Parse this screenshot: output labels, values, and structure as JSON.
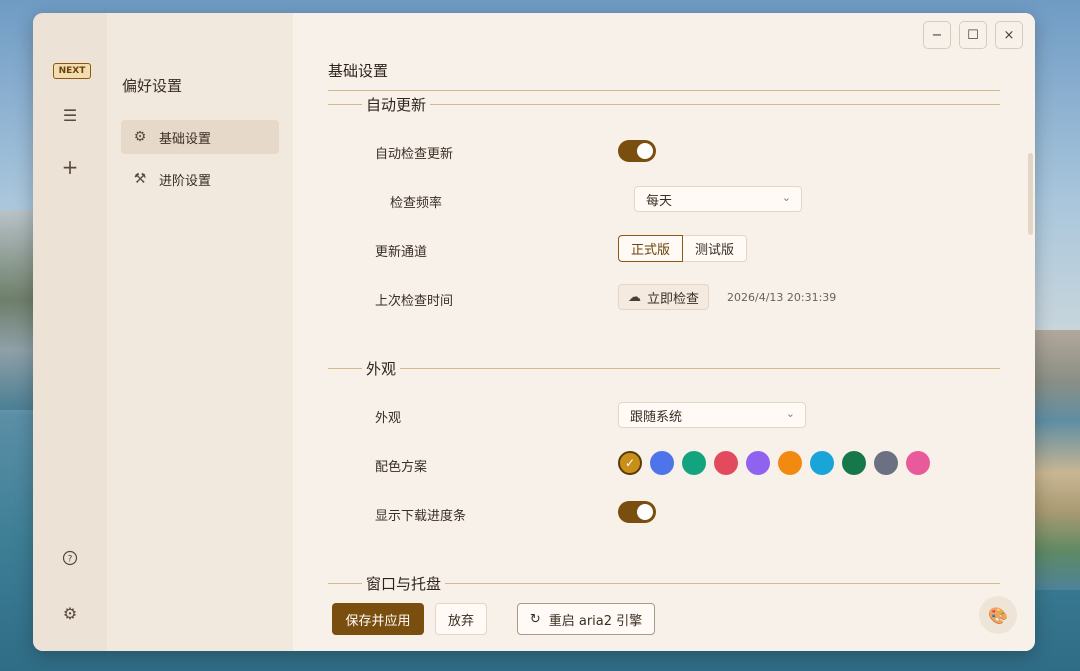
{
  "rail": {
    "logo_text": "NEXT",
    "icons": [
      "list-icon",
      "add-icon",
      "help-icon",
      "settings-icon"
    ]
  },
  "sidebar": {
    "title": "偏好设置",
    "items": [
      {
        "label": "基础设置",
        "icon": "gear-icon",
        "active": true
      },
      {
        "label": "进阶设置",
        "icon": "tools-icon",
        "active": false
      }
    ]
  },
  "window_controls": {
    "minimize": "−",
    "maximize": "☐",
    "close": "×"
  },
  "main": {
    "page_title": "基础设置",
    "sections": {
      "auto_update": {
        "title": "自动更新",
        "auto_check_label": "自动检查更新",
        "auto_check_on": true,
        "frequency_label": "检查频率",
        "frequency_value": "每天",
        "channel_label": "更新通道",
        "channel_options": [
          "正式版",
          "测试版"
        ],
        "channel_selected": "正式版",
        "last_check_label": "上次检查时间",
        "check_now_label": "立即检查",
        "last_check_time": "2026/4/13 20:31:39"
      },
      "appearance": {
        "title": "外观",
        "appearance_label": "外观",
        "appearance_value": "跟随系统",
        "color_scheme_label": "配色方案",
        "colors": [
          "#c8901a",
          "#4f73e8",
          "#14a37f",
          "#e24b5e",
          "#8f63f0",
          "#f28a12",
          "#1aa5d8",
          "#16784a",
          "#6b7082",
          "#e85a9a"
        ],
        "selected_color_index": 0,
        "show_progress_label": "显示下载进度条",
        "show_progress_on": true
      },
      "window_tray": {
        "title": "窗口与托盘"
      }
    }
  },
  "footer": {
    "save_label": "保存并应用",
    "discard_label": "放弃",
    "restart_label": "重启 aria2 引擎"
  }
}
